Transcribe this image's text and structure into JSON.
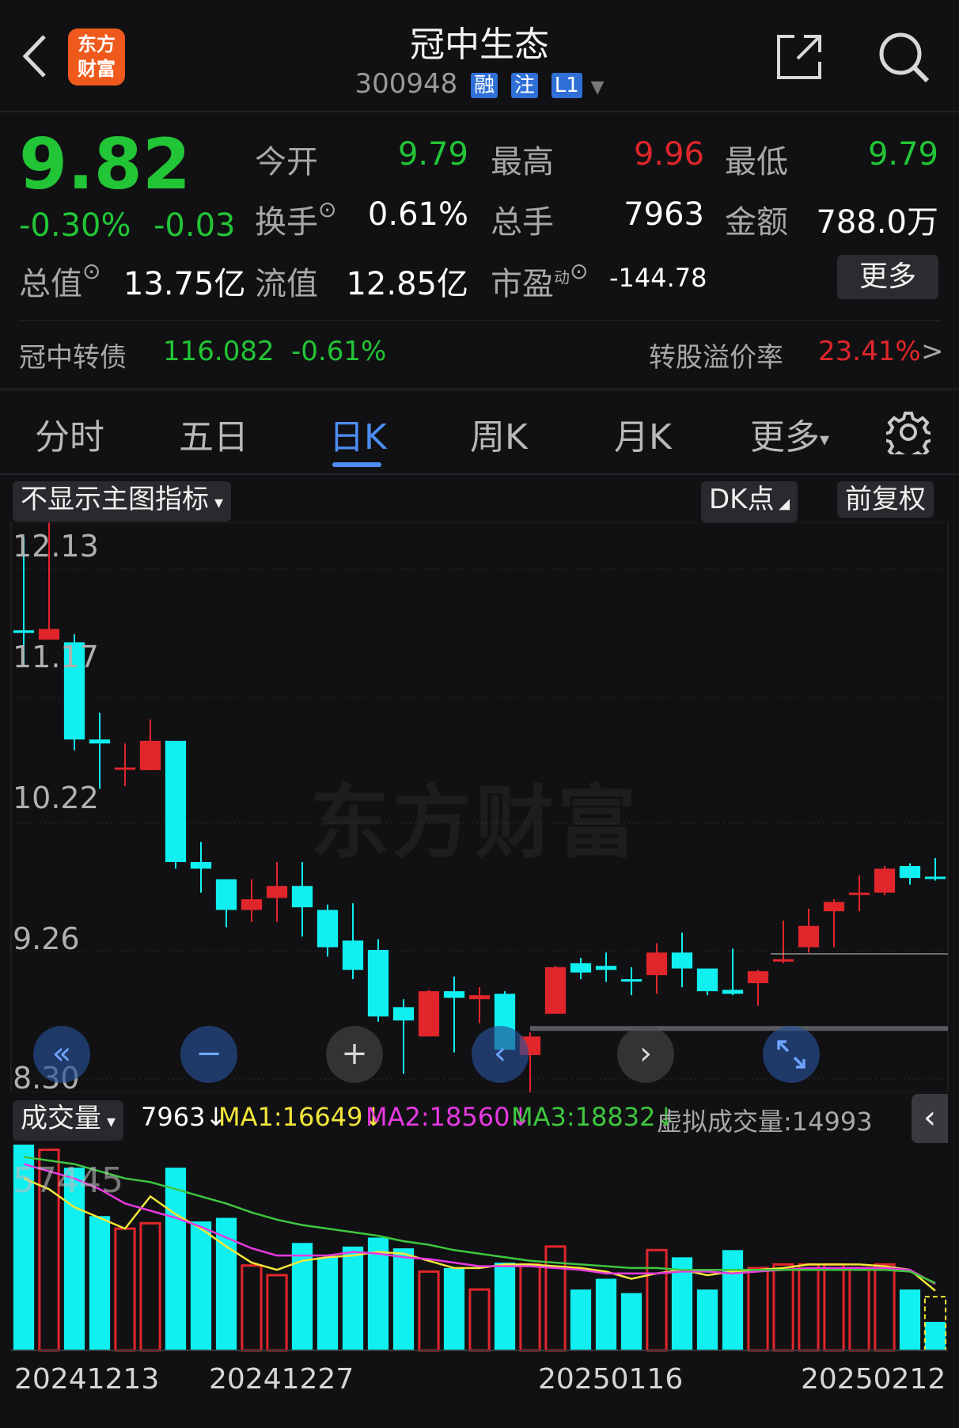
{
  "header": {
    "title": "冠中生态",
    "code": "300948",
    "badges": [
      "融",
      "注",
      "L1"
    ],
    "logo_text_line1": "东方",
    "logo_text_line2": "财富"
  },
  "quote": {
    "price": "9.82",
    "change_pct": "-0.30%",
    "change_abs": "-0.03",
    "open_label": "今开",
    "open_value": "9.79",
    "high_label": "最高",
    "high_value": "9.96",
    "low_label": "最低",
    "low_value": "9.79",
    "turnover_label": "换手",
    "turnover_value": "0.61%",
    "volume_label": "总手",
    "volume_value": "7963",
    "amount_label": "金额",
    "amount_value": "788.0万",
    "total_cap_label": "总值",
    "total_cap_value": "13.75亿",
    "float_cap_label": "流值",
    "float_cap_value": "12.85亿",
    "pe_label": "市盈",
    "pe_sup": "动",
    "pe_value": "-144.78",
    "more_button": "更多"
  },
  "bond": {
    "name": "冠中转债",
    "price": "116.082",
    "change": "-0.61%",
    "premium_label": "转股溢价率",
    "premium_value": "23.41%",
    "chevron": ">"
  },
  "tabs": {
    "items": [
      "分时",
      "五日",
      "日K",
      "周K",
      "月K",
      "更多"
    ],
    "active": "日K"
  },
  "chart_controls": {
    "indicator_select": "不显示主图指标",
    "dk_button": "DK点",
    "adjust_button": "前复权",
    "volume_select": "成交量"
  },
  "volume_legend": {
    "current": "7963↓",
    "ma1": "MA1:16649↓",
    "ma2": "MA2:18560↓",
    "ma3": "MA3:18832↓",
    "virtual": "虚拟成交量:14993",
    "max_label": "57445"
  },
  "watermark": "东方财富",
  "colors": {
    "up": "#e0262b",
    "down": "#22c536",
    "down_candle": "#10f0f0",
    "ma1": "#f2e63a",
    "ma2": "#e63ae0",
    "ma3": "#3fc63f",
    "accent": "#4d8df5"
  },
  "chart_data": {
    "type": "candlestick",
    "y_ticks": [
      "12.13",
      "11.17",
      "10.22",
      "9.26",
      "8.30"
    ],
    "ylim": [
      8.3,
      12.13
    ],
    "x_labels": [
      "20241213",
      "20241227",
      "20250116",
      "20250212"
    ],
    "candles": [
      {
        "o": 11.67,
        "c": 11.65,
        "h": 12.37,
        "l": 11.4
      },
      {
        "o": 11.6,
        "c": 11.68,
        "h": 12.58,
        "l": 11.62
      },
      {
        "o": 11.58,
        "c": 10.85,
        "h": 11.64,
        "l": 10.77
      },
      {
        "o": 10.85,
        "c": 10.82,
        "h": 11.05,
        "l": 10.48
      },
      {
        "o": 10.63,
        "c": 10.64,
        "h": 10.82,
        "l": 10.5
      },
      {
        "o": 10.62,
        "c": 10.84,
        "h": 11.0,
        "l": 10.62
      },
      {
        "o": 10.84,
        "c": 9.93,
        "h": 10.84,
        "l": 9.88
      },
      {
        "o": 9.93,
        "c": 9.88,
        "h": 10.08,
        "l": 9.7
      },
      {
        "o": 9.8,
        "c": 9.57,
        "h": 9.8,
        "l": 9.44
      },
      {
        "o": 9.57,
        "c": 9.65,
        "h": 9.8,
        "l": 9.48
      },
      {
        "o": 9.66,
        "c": 9.75,
        "h": 9.93,
        "l": 9.48
      },
      {
        "o": 9.75,
        "c": 9.59,
        "h": 9.93,
        "l": 9.37
      },
      {
        "o": 9.57,
        "c": 9.29,
        "h": 9.61,
        "l": 9.22
      },
      {
        "o": 9.34,
        "c": 9.12,
        "h": 9.62,
        "l": 9.05
      },
      {
        "o": 9.27,
        "c": 8.77,
        "h": 9.35,
        "l": 8.73
      },
      {
        "o": 8.84,
        "c": 8.74,
        "h": 8.9,
        "l": 8.34
      },
      {
        "o": 8.62,
        "c": 8.96,
        "h": 8.97,
        "l": 8.62
      },
      {
        "o": 8.96,
        "c": 8.91,
        "h": 9.07,
        "l": 8.5
      },
      {
        "o": 8.9,
        "c": 8.93,
        "h": 8.99,
        "l": 8.72
      },
      {
        "o": 8.94,
        "c": 8.52,
        "h": 8.96,
        "l": 8.52
      },
      {
        "o": 8.48,
        "c": 8.62,
        "h": 8.65,
        "l": 8.19
      },
      {
        "o": 8.79,
        "c": 9.14,
        "h": 9.15,
        "l": 8.79
      },
      {
        "o": 9.17,
        "c": 9.1,
        "h": 9.21,
        "l": 9.05
      },
      {
        "o": 9.15,
        "c": 9.12,
        "h": 9.25,
        "l": 9.03
      },
      {
        "o": 9.05,
        "c": 9.04,
        "h": 9.14,
        "l": 8.93
      },
      {
        "o": 9.08,
        "c": 9.25,
        "h": 9.32,
        "l": 8.94
      },
      {
        "o": 9.25,
        "c": 9.13,
        "h": 9.4,
        "l": 8.99
      },
      {
        "o": 9.13,
        "c": 8.96,
        "h": 9.13,
        "l": 8.93
      },
      {
        "o": 8.97,
        "c": 8.94,
        "h": 9.28,
        "l": 8.93
      },
      {
        "o": 9.02,
        "c": 9.11,
        "h": 9.12,
        "l": 8.85
      },
      {
        "o": 9.19,
        "c": 9.2,
        "h": 9.49,
        "l": 9.17
      },
      {
        "o": 9.29,
        "c": 9.45,
        "h": 9.58,
        "l": 9.25
      },
      {
        "o": 9.56,
        "c": 9.63,
        "h": 9.65,
        "l": 9.29
      },
      {
        "o": 9.69,
        "c": 9.7,
        "h": 9.83,
        "l": 9.56
      },
      {
        "o": 9.7,
        "c": 9.88,
        "h": 9.9,
        "l": 9.68
      },
      {
        "o": 9.9,
        "c": 9.81,
        "h": 9.92,
        "l": 9.76
      },
      {
        "o": 9.82,
        "c": 9.81,
        "h": 9.96,
        "l": 9.79
      }
    ],
    "volume": {
      "ymax": 57445,
      "bars": [
        57445,
        56000,
        51000,
        37500,
        34000,
        35500,
        51000,
        36000,
        37000,
        23700,
        21000,
        30000,
        26000,
        29000,
        31500,
        28500,
        22000,
        23000,
        17000,
        24500,
        24000,
        29000,
        17000,
        20000,
        16000,
        28000,
        26000,
        17000,
        28000,
        23000,
        24000,
        24000,
        24000,
        23000,
        24000,
        17000,
        7963
      ],
      "virtual_bar": 14993,
      "ma1": [
        48000,
        45000,
        40000,
        37000,
        34000,
        43000,
        38000,
        34000,
        29000,
        24500,
        22500,
        25000,
        26000,
        26500,
        27500,
        27000,
        25000,
        23000,
        23000,
        24000,
        24000,
        23500,
        23000,
        22000,
        20000,
        21500,
        22500,
        21000,
        22000,
        22500,
        23000,
        24000,
        24000,
        24000,
        23500,
        22500,
        16649
      ],
      "ma2": [
        52000,
        50000,
        48000,
        45000,
        41000,
        39000,
        37000,
        34500,
        31500,
        28500,
        26500,
        26500,
        26500,
        27500,
        27000,
        26000,
        25500,
        24500,
        23500,
        23500,
        23500,
        23000,
        22500,
        21500,
        21500,
        21500,
        22000,
        22000,
        21500,
        22000,
        22500,
        23000,
        23000,
        23000,
        23000,
        22500,
        18560
      ],
      "ma3": [
        54000,
        53000,
        52000,
        50000,
        48000,
        47000,
        45000,
        43000,
        41000,
        38500,
        36500,
        35000,
        34000,
        33000,
        32000,
        30500,
        29500,
        28000,
        27000,
        26000,
        25000,
        24500,
        24000,
        23500,
        23000,
        23000,
        22500,
        22500,
        22500,
        22500,
        22500,
        22500,
        22500,
        22500,
        22500,
        22000,
        18832
      ]
    }
  }
}
